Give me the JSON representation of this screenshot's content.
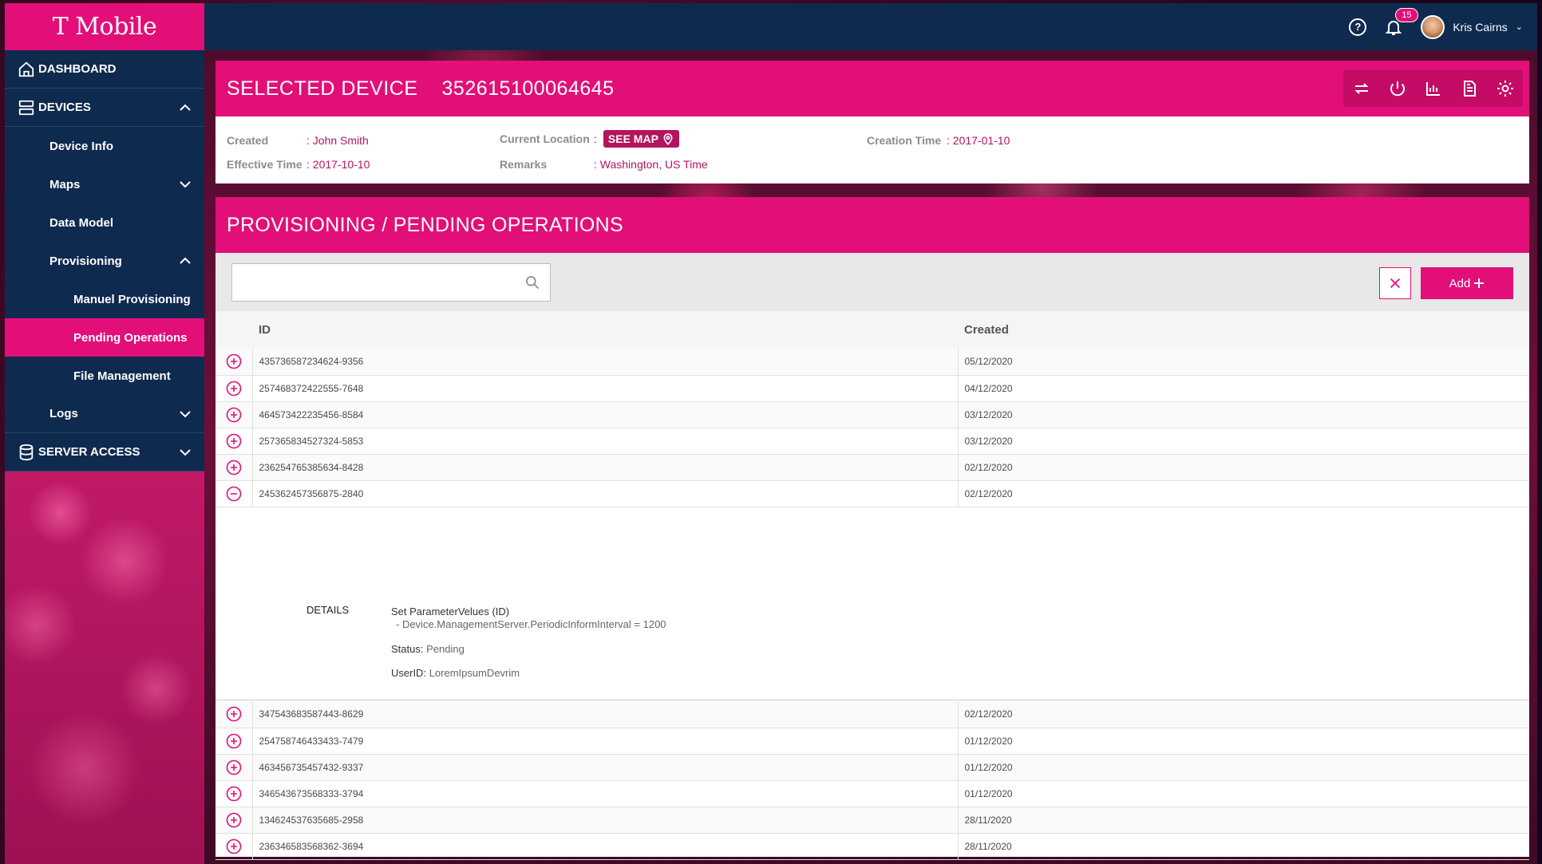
{
  "brand": {
    "logo_text": "T Mobile"
  },
  "topbar": {
    "notifications": "15",
    "user_name": "Kris Cairns"
  },
  "sidebar": {
    "dashboard": "DASHBOARD",
    "devices": "DEVICES",
    "device_info": "Device Info",
    "maps": "Maps",
    "data_model": "Data Model",
    "provisioning": "Provisioning",
    "manual_provisioning": "Manuel Provisioning",
    "pending_operations": "Pending Operations",
    "file_management": "File Management",
    "logs": "Logs",
    "server_access": "SERVER ACCESS"
  },
  "device": {
    "header_label": "SELECTED DEVICE",
    "imei": "352615100064645",
    "created_label": "Created",
    "created_value": ": John Smith",
    "effective_label": "Effective Time",
    "effective_value": ": 2017-10-10",
    "location_label": "Current Location",
    "location_sep": ":",
    "see_map": "SEE MAP",
    "remarks_label": "Remarks",
    "remarks_value": ": Washington, US Time",
    "creation_time_label": "Creation Time",
    "creation_time_value": ": 2017-01-10"
  },
  "provisioning": {
    "title": "PROVISIONING / PENDING OPERATIONS",
    "search_placeholder": "",
    "add_label": "Add",
    "columns": {
      "id": "ID",
      "created": "Created"
    },
    "rows_top": [
      {
        "id": "435736587234624-9356",
        "created": "05/12/2020"
      },
      {
        "id": "257468372422555-7648",
        "created": "04/12/2020"
      },
      {
        "id": "464573422235456-8584",
        "created": "03/12/2020"
      },
      {
        "id": "257365834527324-5853",
        "created": "03/12/2020"
      },
      {
        "id": "236254765385634-8428",
        "created": "02/12/2020"
      },
      {
        "id": "245362457356875-2840",
        "created": "02/12/2020"
      }
    ],
    "details": {
      "label": "DETAILS",
      "operation": "Set ParameterVelues (ID)",
      "parameter": "- Device.ManagementServer.PeriodicInformInterval = 1200",
      "status_label": "Status:",
      "status_value": "Pending",
      "user_label": "UserID:",
      "user_value": "LoremIpsumDevrim"
    },
    "rows_bottom": [
      {
        "id": "347543683587443-8629",
        "created": "02/12/2020"
      },
      {
        "id": "254758746433433-7479",
        "created": "01/12/2020"
      },
      {
        "id": "463456735457432-9337",
        "created": "01/12/2020"
      },
      {
        "id": "346543673568333-3794",
        "created": "01/12/2020"
      },
      {
        "id": "134624537635685-2958",
        "created": "28/11/2020"
      },
      {
        "id": "236346583568362-3694",
        "created": "28/11/2020"
      }
    ]
  },
  "colors": {
    "magenta": "#e20f78",
    "navy": "#0f2a4f",
    "dark_magenta": "#b3145f"
  }
}
